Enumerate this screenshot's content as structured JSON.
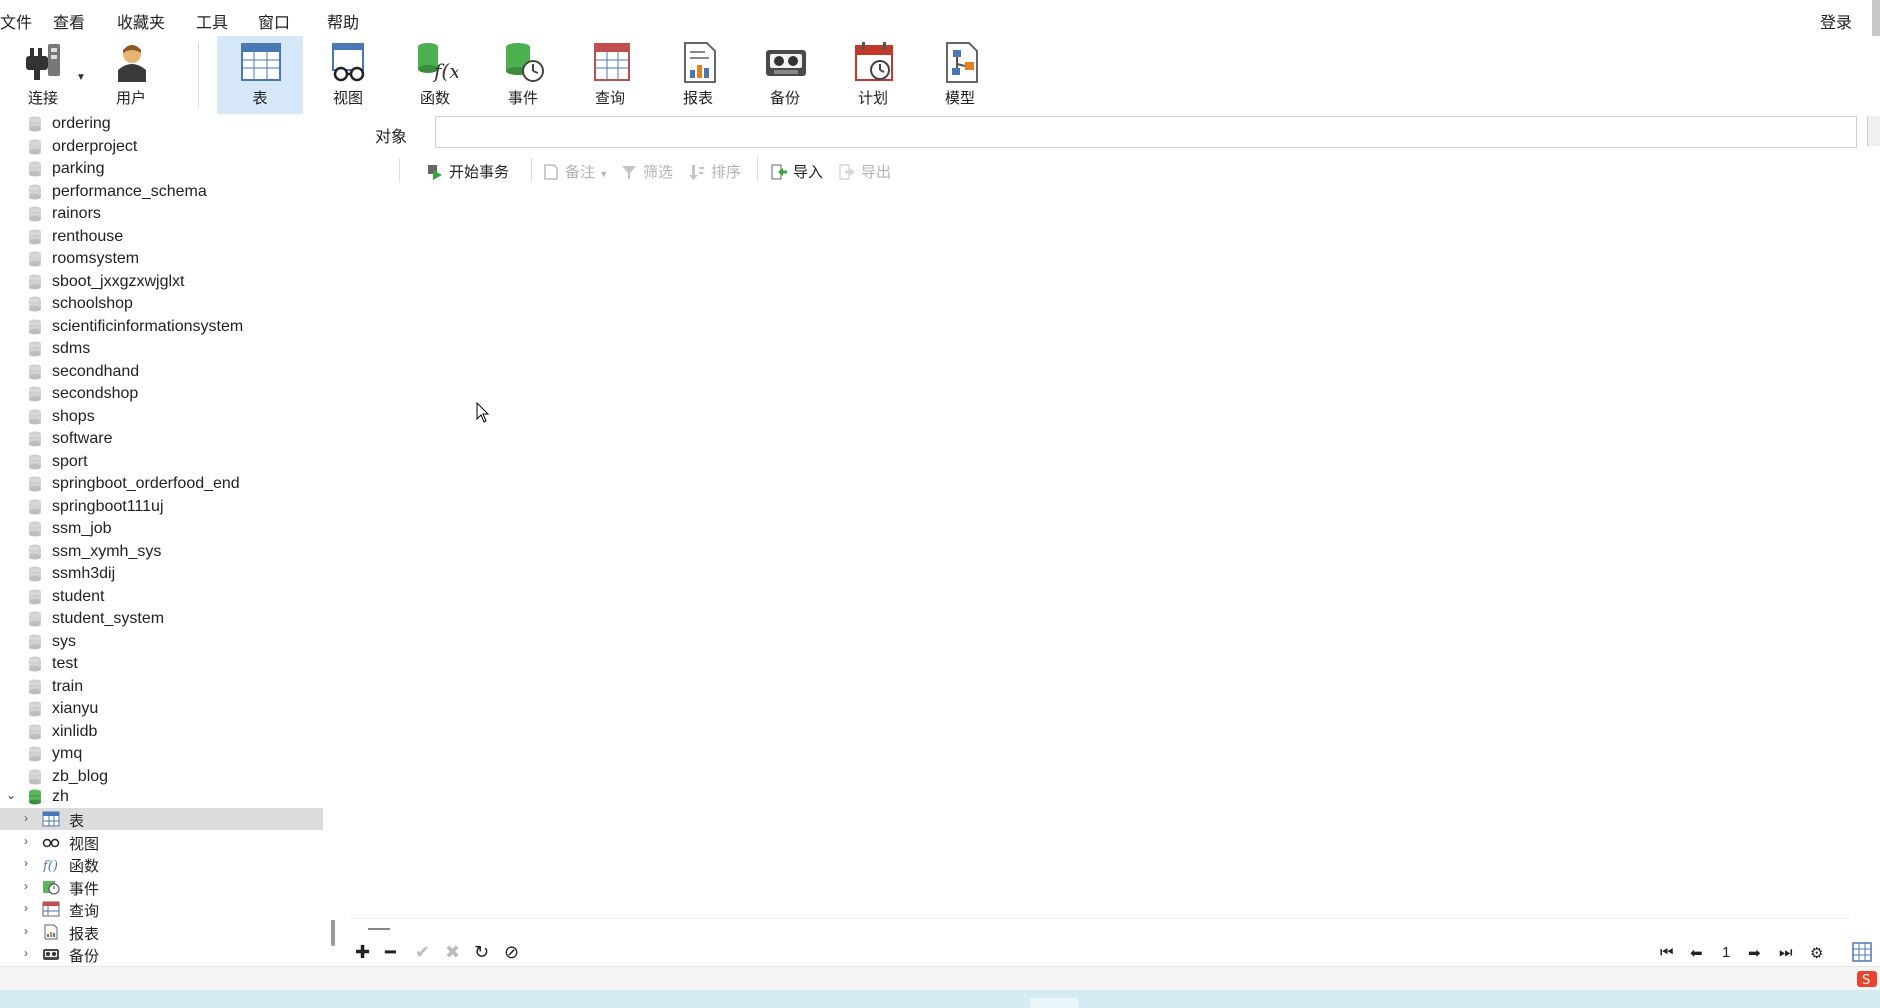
{
  "menu": {
    "items": [
      "文件",
      "查看",
      "收藏夹",
      "工具",
      "窗口",
      "帮助"
    ],
    "login": "登录"
  },
  "toolbar": {
    "connect": "连接",
    "user": "用户",
    "table": "表",
    "view": "视图",
    "function": "函数",
    "event": "事件",
    "query": "查询",
    "report": "报表",
    "backup": "备份",
    "schedule": "计划",
    "model": "模型"
  },
  "tree": {
    "databases": [
      "ordering",
      "orderproject",
      "parking",
      "performance_schema",
      "rainors",
      "renthouse",
      "roomsystem",
      "sboot_jxxgzxwjglxt",
      "schoolshop",
      "scientificinformationsystem",
      "sdms",
      "secondhand",
      "secondshop",
      "shops",
      "software",
      "sport",
      "springboot_orderfood_end",
      "springboot111uj",
      "ssm_job",
      "ssm_xymh_sys",
      "ssmh3dij",
      "student",
      "student_system",
      "sys",
      "test",
      "train",
      "xianyu",
      "xinlidb",
      "ymq",
      "zb_blog"
    ],
    "open_db": "zh",
    "children": [
      "表",
      "视图",
      "函数",
      "事件",
      "查询",
      "报表",
      "备份"
    ]
  },
  "main": {
    "object_tab": "对象",
    "actions": {
      "begin_tx": "开始事务",
      "memo": "备注",
      "filter": "筛选",
      "sort": "排序",
      "import": "导入",
      "export": "导出"
    }
  },
  "pager": {
    "page": "1"
  }
}
